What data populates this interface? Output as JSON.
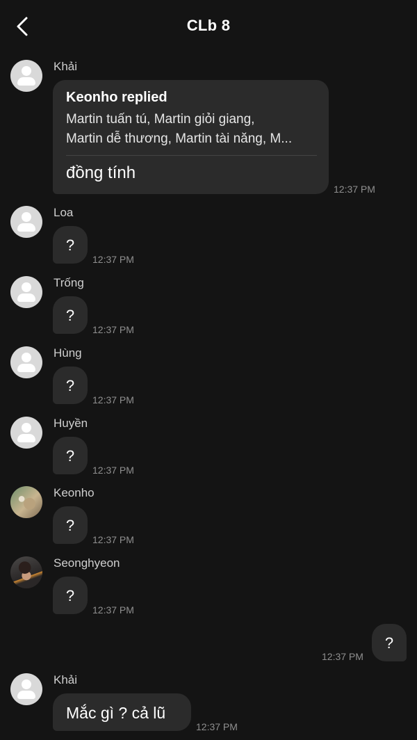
{
  "header": {
    "title": "CLb 8"
  },
  "reply_message": {
    "sender": "Khải",
    "reply_title": "Keonho  replied",
    "quoted_line1": "Martin tuấn tú, Martin giỏi giang,",
    "quoted_line2": "Martin dễ thương, Martin tài năng, M...",
    "text": "đồng tính",
    "time": "12:37 PM"
  },
  "messages": [
    {
      "sender": "Loa",
      "text": "?",
      "time": "12:37 PM"
    },
    {
      "sender": "Trống",
      "text": "?",
      "time": "12:37 PM"
    },
    {
      "sender": "Hùng",
      "text": "?",
      "time": "12:37 PM"
    },
    {
      "sender": "Huyền",
      "text": "?",
      "time": "12:37 PM"
    },
    {
      "sender": "Keonho",
      "text": "?",
      "time": "12:37 PM"
    },
    {
      "sender": "Seonghyeon",
      "text": "?",
      "time": "12:37 PM"
    }
  ],
  "my_message": {
    "text": "?",
    "time": "12:37 PM"
  },
  "last_message": {
    "sender": "Khải",
    "text": "Mắc gì ? cả lũ",
    "time": "12:37 PM"
  },
  "icons": {
    "back": "chevron-left-icon",
    "avatar_placeholder": "person-icon"
  },
  "colors": {
    "background": "#141414",
    "bubble": "#2b2b2b",
    "timestamp": "#8f8f8f"
  }
}
